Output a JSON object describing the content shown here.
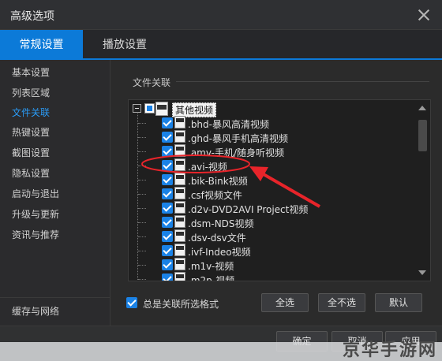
{
  "window": {
    "title": "高级选项"
  },
  "tabs": [
    {
      "label": "常规设置",
      "active": true
    },
    {
      "label": "播放设置",
      "active": false
    }
  ],
  "sidebar": {
    "items": [
      {
        "label": "基本设置"
      },
      {
        "label": "列表区域"
      },
      {
        "label": "文件关联",
        "active": true
      },
      {
        "label": "热键设置"
      },
      {
        "label": "截图设置"
      },
      {
        "label": "隐私设置"
      },
      {
        "label": "启动与退出"
      },
      {
        "label": "升级与更新"
      },
      {
        "label": "资讯与推荐"
      }
    ],
    "bottom_label": "缓存与网络"
  },
  "file_assoc": {
    "group_label": "文件关联",
    "root_label": "其他视频",
    "items": [
      {
        "label": ".bhd-暴风高清视频"
      },
      {
        "label": ".ghd-暴风手机高清视频"
      },
      {
        "label": ".amv-手机/随身听视频"
      },
      {
        "label": ".avi-视频",
        "highlighted": true
      },
      {
        "label": ".bik-Bink视频"
      },
      {
        "label": ".csf视频文件"
      },
      {
        "label": ".d2v-DVD2AVI Project视频"
      },
      {
        "label": ".dsm-NDS视频"
      },
      {
        "label": ".dsv-dsv文件"
      },
      {
        "label": ".ivf-Indeo视频"
      },
      {
        "label": ".m1v-视频"
      },
      {
        "label": ".m2p-视频"
      }
    ],
    "always_assoc_label": "总是关联所选格式",
    "select_all_label": "全选",
    "select_none_label": "全不选",
    "default_label": "默认"
  },
  "footer": {
    "ok_label": "确定",
    "cancel_label": "取消",
    "apply_label": "应用"
  },
  "watermark": "京华手游网",
  "colors": {
    "accent": "#0c7ad8",
    "annotation": "#e8242a"
  }
}
